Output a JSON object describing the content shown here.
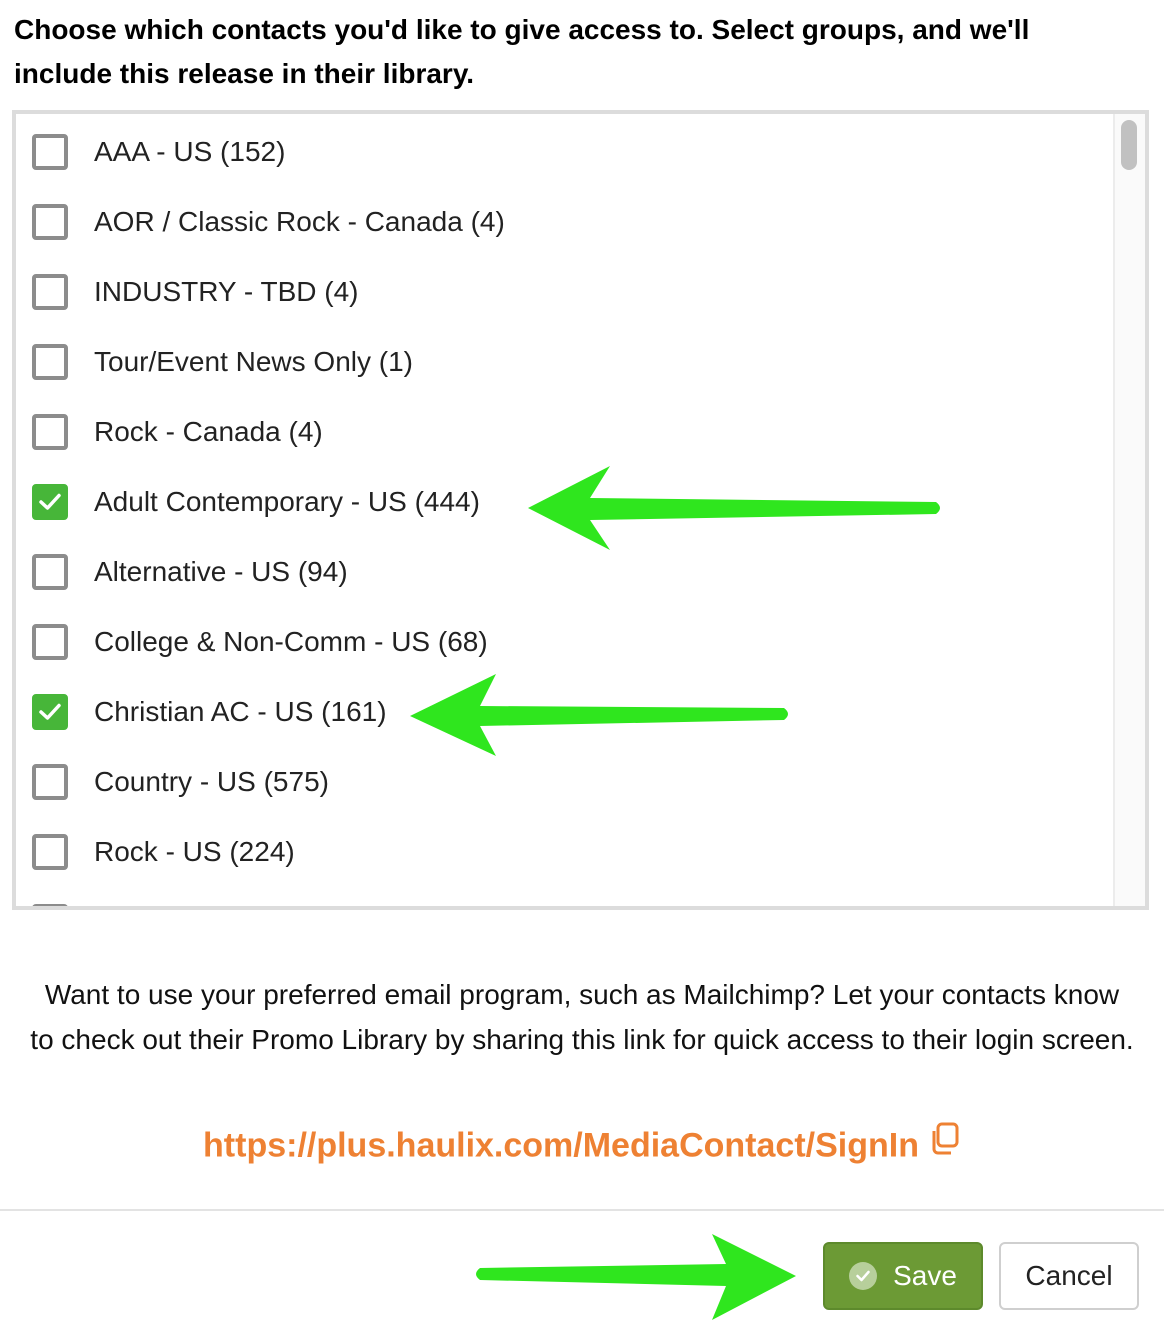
{
  "instructions": "Choose which contacts you'd like to give access to. Select groups, and we'll include this release in their library.",
  "groups": [
    {
      "label": "AAA - US (152)",
      "checked": false
    },
    {
      "label": "AOR / Classic Rock - Canada (4)",
      "checked": false
    },
    {
      "label": "INDUSTRY - TBD (4)",
      "checked": false
    },
    {
      "label": "Tour/Event News Only (1)",
      "checked": false
    },
    {
      "label": "Rock - Canada (4)",
      "checked": false
    },
    {
      "label": "Adult Contemporary - US (444)",
      "checked": true
    },
    {
      "label": "Alternative - US (94)",
      "checked": false
    },
    {
      "label": "College & Non-Comm - US (68)",
      "checked": false
    },
    {
      "label": "Christian AC - US (161)",
      "checked": true
    },
    {
      "label": "Country - US (575)",
      "checked": false
    },
    {
      "label": "Rock - US (224)",
      "checked": false
    }
  ],
  "info_text": "Want to use your preferred email program, such as Mailchimp? Let your contacts know to check out their Promo Library by sharing this link for quick access to their login screen.",
  "signin_link": "https://plus.haulix.com/MediaContact/SignIn",
  "buttons": {
    "save": "Save",
    "cancel": "Cancel"
  },
  "colors": {
    "checked": "#47b639",
    "link": "#ee8133",
    "save_button": "#6c9a35",
    "annotation_arrow": "#2fe61e"
  }
}
